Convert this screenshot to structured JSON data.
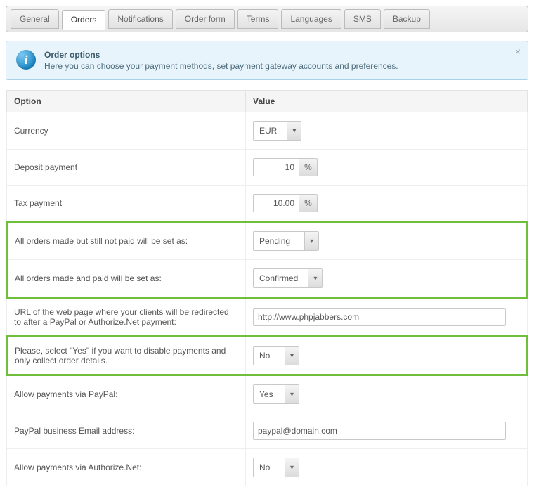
{
  "tabs": [
    "General",
    "Orders",
    "Notifications",
    "Order form",
    "Terms",
    "Languages",
    "SMS",
    "Backup"
  ],
  "active_tab": "Orders",
  "info": {
    "title": "Order options",
    "body": "Here you can choose your payment methods, set payment gateway accounts and preferences."
  },
  "columns": {
    "option": "Option",
    "value": "Value"
  },
  "rows": {
    "currency": {
      "label": "Currency",
      "value": "EUR"
    },
    "deposit": {
      "label": "Deposit payment",
      "value": "10",
      "suffix": "%"
    },
    "tax": {
      "label": "Tax payment",
      "value": "10.00",
      "suffix": "%"
    },
    "status_unpaid": {
      "label": "All orders made but still not paid will be set as:",
      "value": "Pending"
    },
    "status_paid": {
      "label": "All orders made and paid will be set as:",
      "value": "Confirmed"
    },
    "redirect_url": {
      "label": "URL of the web page where your clients will be redirected to after a PayPal or Authorize.Net payment:",
      "value": "http://www.phpjabbers.com"
    },
    "disable_pay": {
      "label": "Please, select \"Yes\" if you want to disable payments and only collect order details.",
      "value": "No"
    },
    "allow_paypal": {
      "label": "Allow payments via PayPal:",
      "value": "Yes"
    },
    "paypal_email": {
      "label": "PayPal business Email address:",
      "value": "paypal@domain.com"
    },
    "allow_authorize": {
      "label": "Allow payments via Authorize.Net:",
      "value": "No"
    }
  }
}
